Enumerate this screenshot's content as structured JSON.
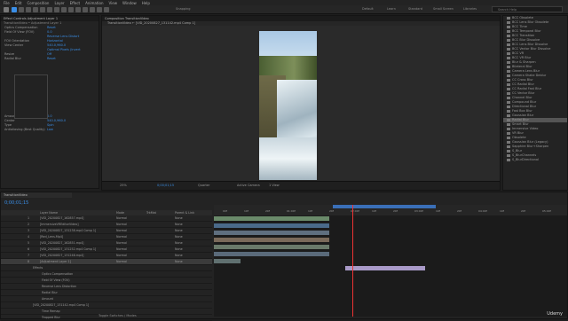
{
  "menu": [
    "File",
    "Edit",
    "Composition",
    "Layer",
    "Effect",
    "Animation",
    "View",
    "Window",
    "Help"
  ],
  "toolbar": {
    "snapping": "Snapping",
    "workspaces": [
      "Default",
      "Learn",
      "Standard",
      "Small Screen",
      "Libraries"
    ],
    "search_placeholder": "Search Help"
  },
  "effect_controls": {
    "tab": "Effect Controls Adjustment Layer 1",
    "sub": "TransitionVideo • Adjustment Layer 1",
    "rows": [
      {
        "label": "Optics Compensation",
        "value": "Reset"
      },
      {
        "label": "Field Of View (FOV)",
        "value": "0.0"
      },
      {
        "label": "",
        "value": "Reverse Lens Distort"
      },
      {
        "label": "FOV Orientation",
        "value": "Horizontal"
      },
      {
        "label": "View Center",
        "value": "540.0,960.0"
      },
      {
        "label": "",
        "value": "Optimal Pixels (Invert"
      },
      {
        "label": "Resize",
        "value": "Off"
      },
      {
        "label": "Radial Blur",
        "value": "Reset"
      },
      {
        "label": "Amount",
        "value": "0.0"
      },
      {
        "label": "Center",
        "value": "540.0,960.0"
      },
      {
        "label": "Type",
        "value": "Spin"
      },
      {
        "label": "Antialiasing (Best Quality)",
        "value": "Low"
      }
    ]
  },
  "composition": {
    "tab": "Composition TransitionVideo",
    "breadcrumb": "TransitionVideo ← [VID_20200827_131142.mp4 Comp 1]",
    "zoom": "25%",
    "timecode": "0;00;01;15",
    "quality": "Quarter",
    "camera": "Active Camera",
    "view": "1 View"
  },
  "effects_presets": {
    "items": [
      {
        "text": "BCC Obsolete",
        "selected": false
      },
      {
        "text": "BCC Lens Blur Obsolete",
        "selected": false
      },
      {
        "text": "BCC Time",
        "selected": false
      },
      {
        "text": "BCC Temporal Blur",
        "selected": false
      },
      {
        "text": "BCC Transition",
        "selected": false
      },
      {
        "text": "BCC Blur Dissolve",
        "selected": false
      },
      {
        "text": "BCC Lens Blur Dissolve",
        "selected": false
      },
      {
        "text": "BCC Vector Blur Dissolve",
        "selected": false
      },
      {
        "text": "BCC VR",
        "selected": false
      },
      {
        "text": "BCC VR Blur",
        "selected": false
      },
      {
        "text": "Blur & Sharpen",
        "selected": false
      },
      {
        "text": "Bilateral Blur",
        "selected": false
      },
      {
        "text": "Camera Lens Blur",
        "selected": false
      },
      {
        "text": "Camera Shake Deblur",
        "selected": false
      },
      {
        "text": "CC Cross Blur",
        "selected": false
      },
      {
        "text": "CC Radial Blur",
        "selected": false
      },
      {
        "text": "CC Radial Fast Blur",
        "selected": false
      },
      {
        "text": "CC Vector Blur",
        "selected": false
      },
      {
        "text": "Channel Blur",
        "selected": false
      },
      {
        "text": "Compound Blur",
        "selected": false
      },
      {
        "text": "Directional Blur",
        "selected": false
      },
      {
        "text": "Fast Box Blur",
        "selected": false
      },
      {
        "text": "Gaussian Blur",
        "selected": false
      },
      {
        "text": "Radial Blur",
        "selected": true
      },
      {
        "text": "Smart Blur",
        "selected": false
      },
      {
        "text": "Immersive Video",
        "selected": false
      },
      {
        "text": "VR Blur",
        "selected": false
      },
      {
        "text": "Obsolete",
        "selected": false
      },
      {
        "text": "Gaussian Blur (Legacy)",
        "selected": false
      },
      {
        "text": "Sapphire Blur+Sharpen",
        "selected": false
      },
      {
        "text": "S_Blur",
        "selected": false
      },
      {
        "text": "S_BlurChannels",
        "selected": false
      },
      {
        "text": "S_BlurDirectional",
        "selected": false
      }
    ]
  },
  "timeline": {
    "tab": "TransitionVideo",
    "timecode": "0;00;01;15",
    "headers": {
      "name": "Layer Name",
      "mode": "Mode",
      "trkmat": "TrkMat",
      "parent": "Parent & Link"
    },
    "layers": [
      {
        "num": "1",
        "name": "[VID_20200827_162857.mp4]",
        "mode": "Normal",
        "parent": "None"
      },
      {
        "num": "2",
        "name": "[ImmersiveVREditorVideo]",
        "mode": "Normal",
        "parent": "None"
      },
      {
        "num": "3",
        "name": "[VID_20200827_131238.mp4 Comp 1]",
        "mode": "Normal",
        "parent": "None"
      },
      {
        "num": "4",
        "name": "[Red_Lens.Mp4]",
        "mode": "Normal",
        "parent": "None"
      },
      {
        "num": "5",
        "name": "[VID_20200827_162851.mp4]",
        "mode": "Normal",
        "parent": "None"
      },
      {
        "num": "6",
        "name": "[VID_20200827_131252.mp4 Comp 1]",
        "mode": "Normal",
        "parent": "None"
      },
      {
        "num": "7",
        "name": "[VID_20200827_131246.mp4]",
        "mode": "Normal",
        "parent": "None"
      },
      {
        "num": "8",
        "name": "[Adjustment Layer 1]",
        "mode": "Normal",
        "parent": "None"
      }
    ],
    "sublayers": [
      {
        "name": "Effects"
      },
      {
        "name": "Optics Compensation"
      },
      {
        "name": "Field Of View (FOV)"
      },
      {
        "name": "Reverse Lens Distortion"
      },
      {
        "name": "Radial Blur"
      },
      {
        "name": "Amount"
      },
      {
        "name": "[VID_20200827_131142.mp4 Comp 1]"
      },
      {
        "name": "Time Remap"
      },
      {
        "name": "Trapped Blur"
      }
    ],
    "ruler": [
      "00f",
      "10f",
      "20f",
      "01:00f",
      "10f",
      "20f",
      "02:00f",
      "10f",
      "20f",
      "03:00f",
      "10f",
      "20f",
      "04:00f",
      "10f",
      "20f",
      "05:00f"
    ],
    "footer": "Toggle Switches / Modes"
  },
  "brand": "Udemy"
}
